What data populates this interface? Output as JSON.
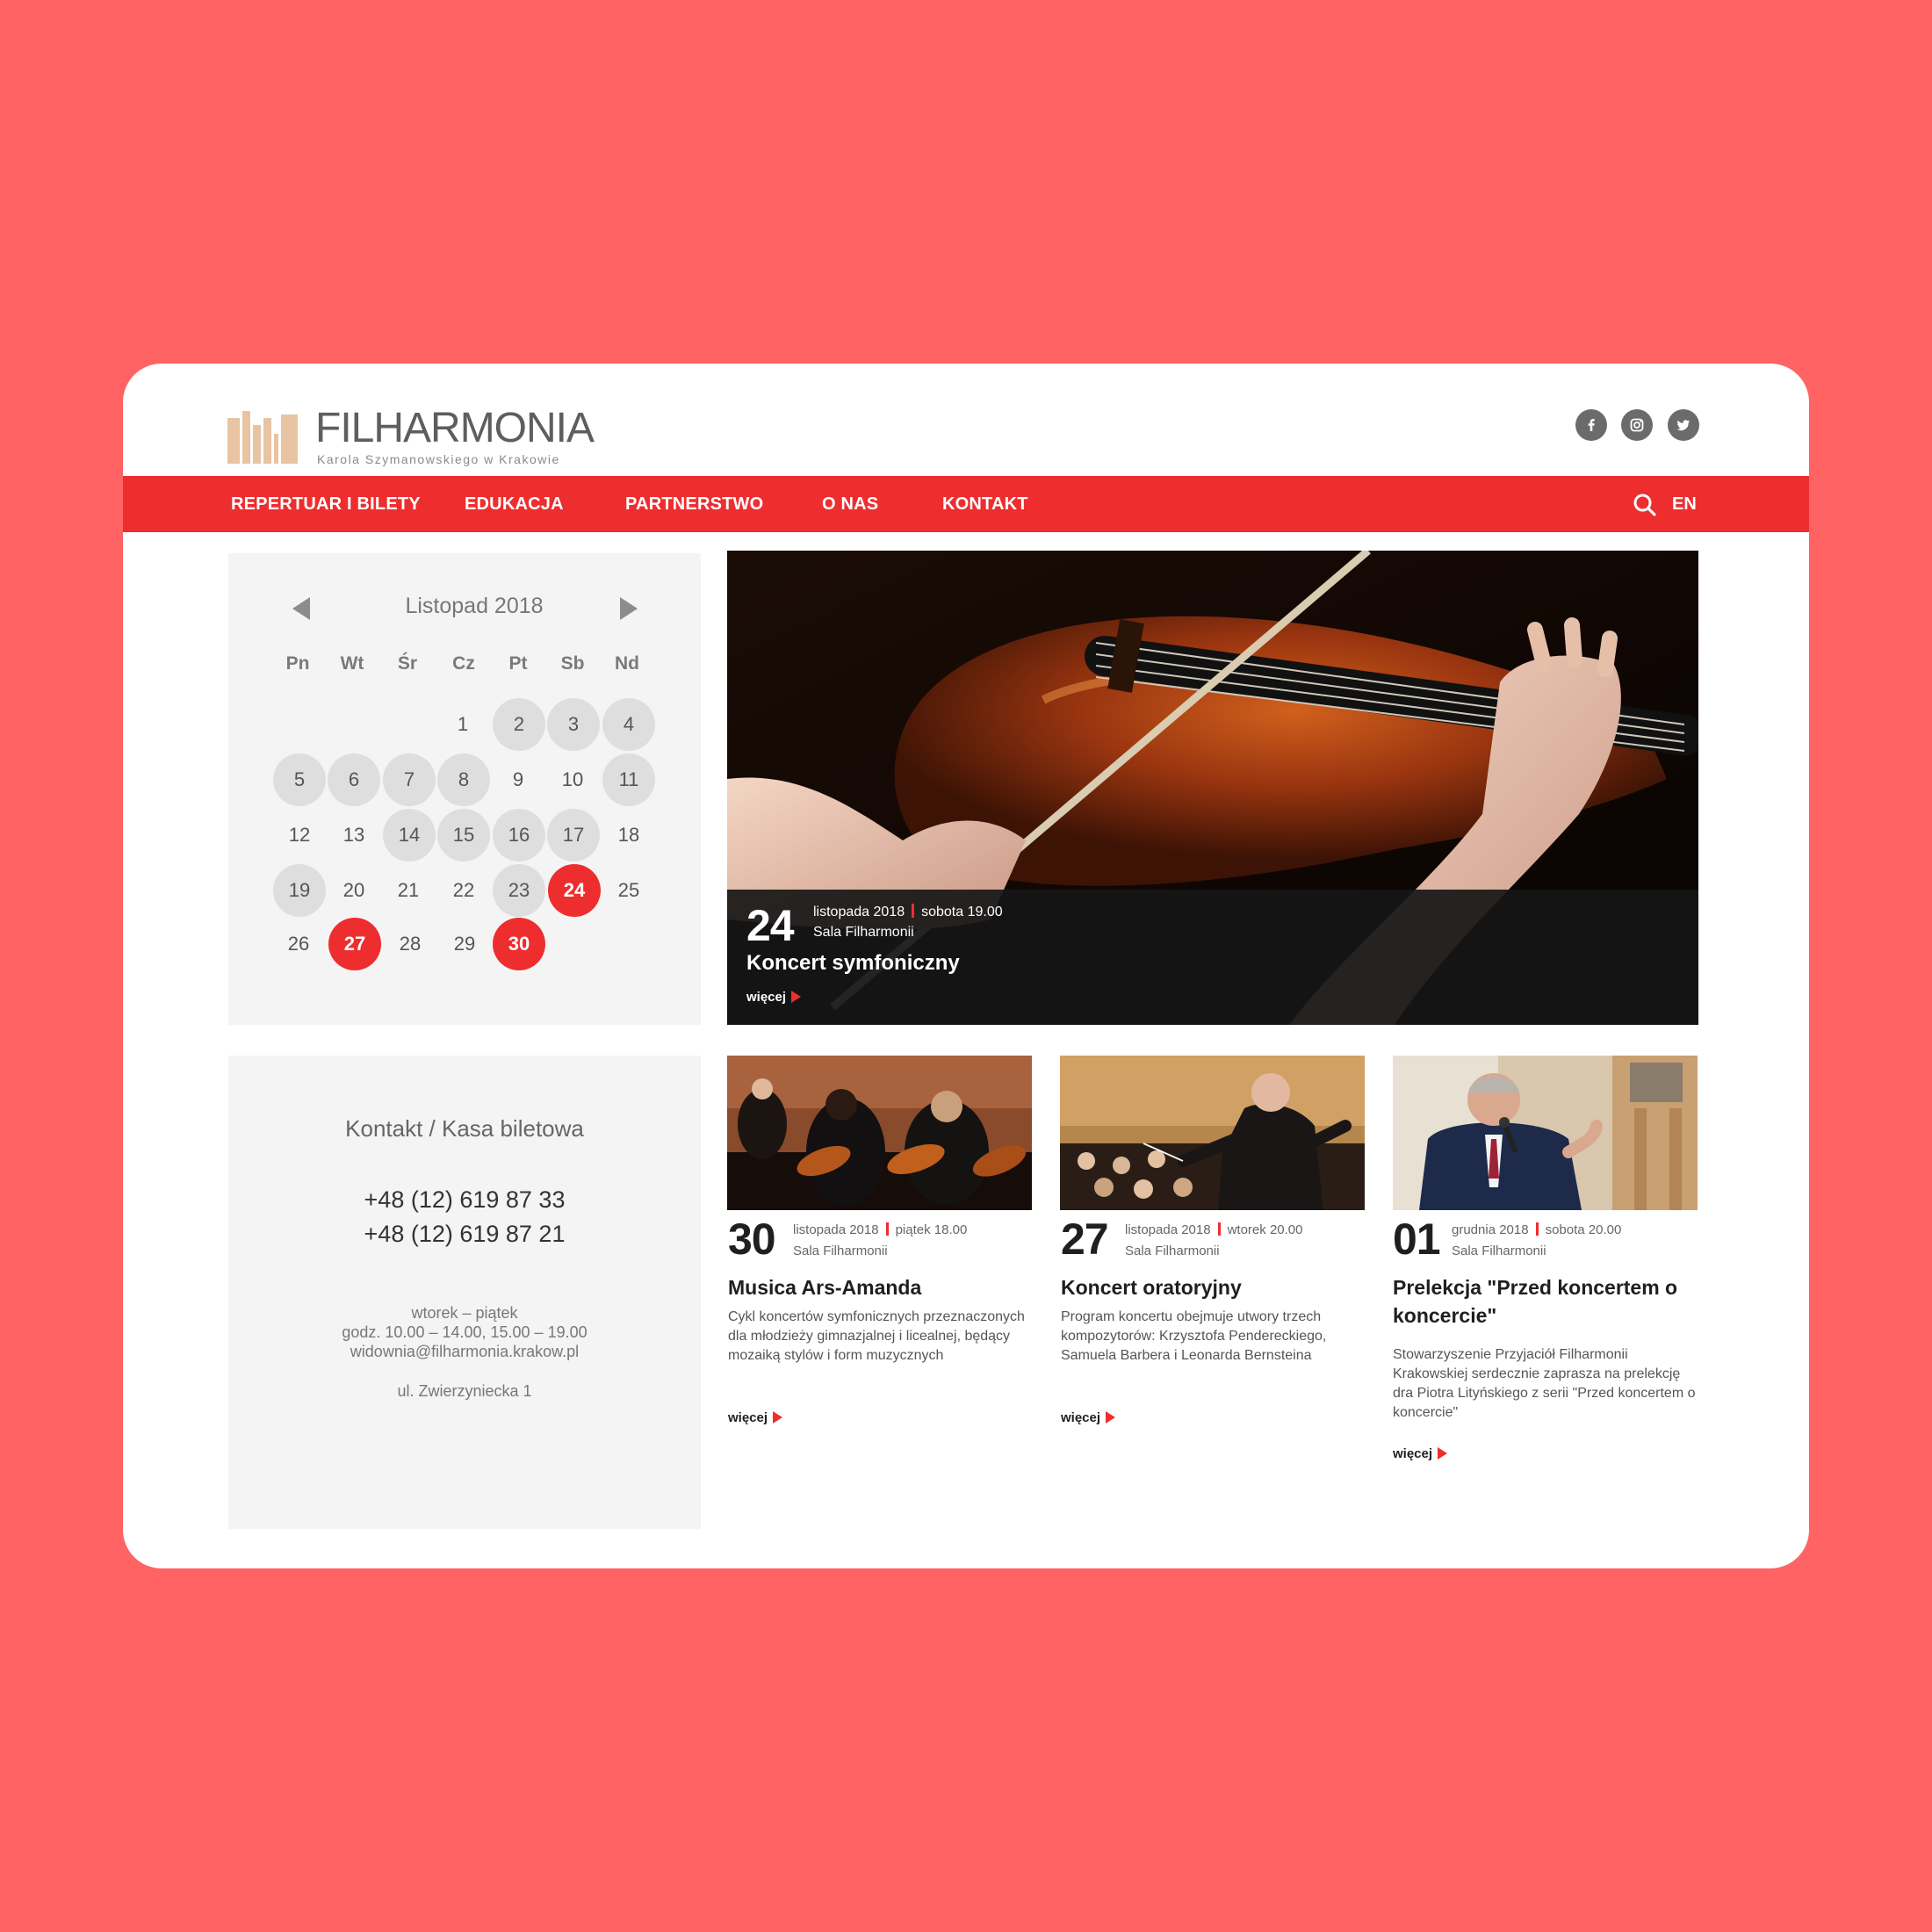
{
  "brand": {
    "title": "FILHARMONIA",
    "subtitle": "Karola Szymanowskiego w Krakowie"
  },
  "social": [
    "facebook-icon",
    "instagram-icon",
    "twitter-icon"
  ],
  "nav": {
    "items": [
      "REPERTUAR I BILETY",
      "EDUKACJA",
      "PARTNERSTWO",
      "O NAS",
      "KONTAKT"
    ],
    "lang": "EN"
  },
  "calendar": {
    "month": "Listopad 2018",
    "weekdays": [
      "Pn",
      "Wt",
      "Śr",
      "Cz",
      "Pt",
      "Sb",
      "Nd"
    ],
    "weeks": [
      [
        "",
        "",
        "",
        "1",
        "2",
        "3",
        "4"
      ],
      [
        "5",
        "6",
        "7",
        "8",
        "9",
        "10",
        "11"
      ],
      [
        "12",
        "13",
        "14",
        "15",
        "16",
        "17",
        "18"
      ],
      [
        "19",
        "20",
        "21",
        "22",
        "23",
        "24",
        "25"
      ],
      [
        "26",
        "27",
        "28",
        "29",
        "30",
        "",
        ""
      ]
    ]
  },
  "hero": {
    "day": "24",
    "date": "listopada 2018",
    "time": "sobota 19.00",
    "venue": "Sala Filharmonii",
    "title": "Koncert symfoniczny",
    "more": "więcej"
  },
  "contact": {
    "title": "Kontakt / Kasa biletowa",
    "phone1": "+48 (12) 619 87 33",
    "phone2": "+48 (12) 619 87 21",
    "days": "wtorek – piątek",
    "hours": "godz. 10.00 – 14.00, 15.00 – 19.00",
    "email": "widownia@filharmonia.krakow.pl",
    "address": "ul. Zwierzyniecka 1"
  },
  "news": [
    {
      "day": "30",
      "date": "listopada 2018",
      "time": "piątek 18.00",
      "venue": "Sala Filharmonii",
      "title": "Musica Ars-Amanda",
      "desc": "Cykl koncertów symfonicznych przeznaczonych dla młodzieży gimnazjalnej i licealnej, będący mozaiką stylów i form muzycznych",
      "more": "więcej"
    },
    {
      "day": "27",
      "date": "listopada 2018",
      "time": "wtorek 20.00",
      "venue": "Sala Filharmonii",
      "title": "Koncert oratoryjny",
      "desc": "Program koncertu obejmuje utwory trzech kompozytorów: Krzysztofa Pendereckiego, Samuela Barbera i Leonarda Bernsteina",
      "more": "więcej"
    },
    {
      "day": "01",
      "date": "grudnia 2018",
      "time": "sobota 20.00",
      "venue": "Sala Filharmonii",
      "title": "Prelekcja \"Przed koncertem o koncercie\"",
      "desc": "Stowarzyszenie Przyjaciół Filharmonii Krakowskiej serdecznie zaprasza na prelekcję dra Piotra Lityńskiego z serii \"Przed koncertem o koncercie\"",
      "more": "więcej"
    }
  ],
  "colors": {
    "background": "#ff6363",
    "accent": "#ee2d2f",
    "logo": "#e8c4a2",
    "panel": "#f4f4f4"
  }
}
